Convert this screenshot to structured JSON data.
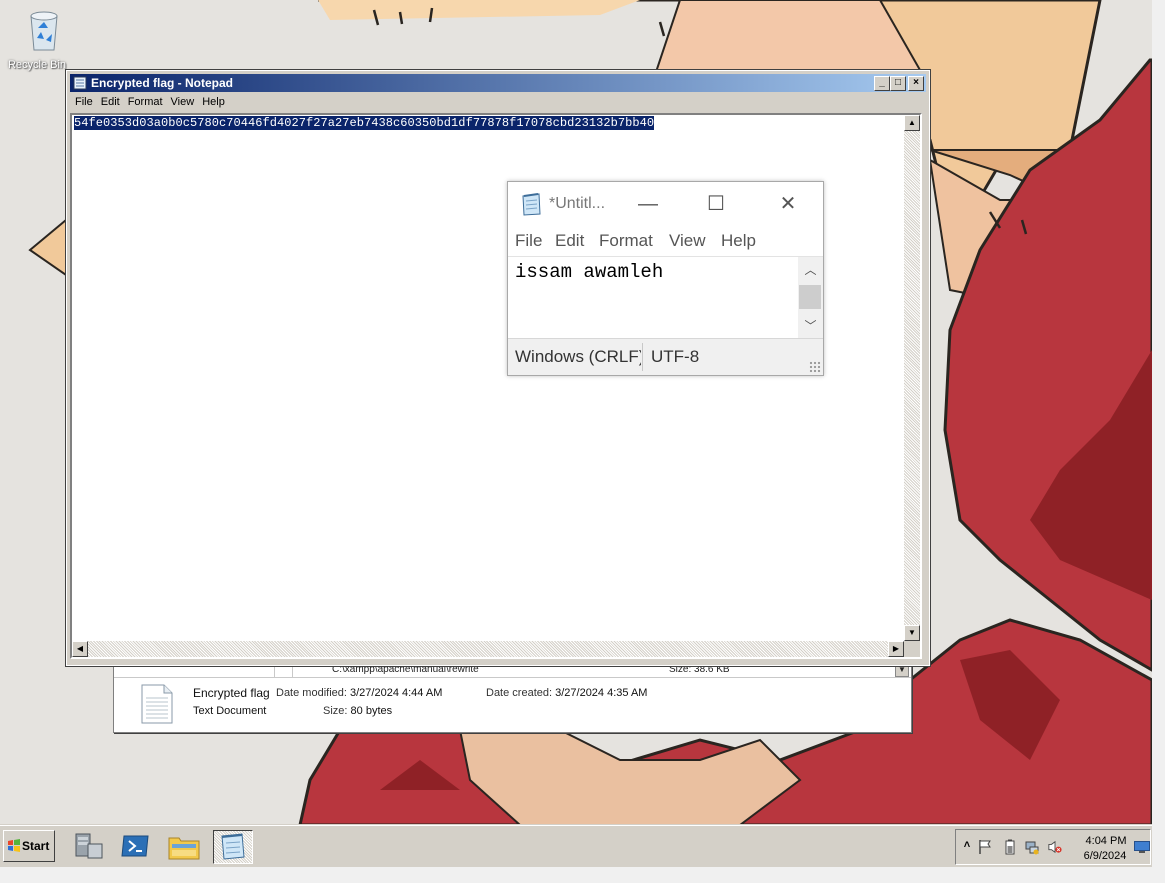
{
  "desktop": {
    "icons": [
      {
        "label": "Recycle Bin",
        "icon": "recycle-bin-icon"
      }
    ]
  },
  "explorer": {
    "path": "C:\\xampp\\apache\\manual\\rewrite",
    "path_size": "Size: 38.6 KB",
    "details": {
      "name": "Encrypted flag",
      "type": "Text Document",
      "modified_label": "Date modified:",
      "modified": "3/27/2024 4:44 AM",
      "created_label": "Date created:",
      "created": "3/27/2024 4:35 AM",
      "size_label": "Size:",
      "size": "80 bytes",
      "icon": "text-document-icon"
    }
  },
  "notepad_classic": {
    "title": "Encrypted flag - Notepad",
    "menu": [
      "File",
      "Edit",
      "Format",
      "View",
      "Help"
    ],
    "content": "54fe0353d03a0b0c5780c70446fd4027f27a27eb7438c60350bd1df77878f17078cbd23132b7bb40",
    "content_selected": true,
    "buttons": {
      "minimize": "_",
      "maximize": "□",
      "close": "×"
    }
  },
  "notepad_modern": {
    "title": "*Untitl...",
    "menu": [
      "File",
      "Edit",
      "Format",
      "View",
      "Help"
    ],
    "content": "issam awamleh",
    "status_line_ending": "Windows (CRLF)",
    "status_encoding": "UTF-8"
  },
  "taskbar": {
    "start_label": "Start",
    "apps": [
      "server-manager-icon",
      "powershell-icon",
      "file-explorer-icon",
      "notepad-icon"
    ],
    "active_app": "notepad-icon",
    "tray_icons": [
      "show-hidden-icons-chevron",
      "action-center-flag-icon",
      "battery-icon",
      "network-icon",
      "volume-muted-icon"
    ],
    "time": "4:04 PM",
    "date": "6/9/2024",
    "show_desktop_icon": "show-desktop-icon"
  },
  "colors": {
    "title_active_start": "#0a246a",
    "title_active_end": "#a6caf0",
    "selection": "#0a246a",
    "face": "#d4d0c8",
    "wallpaper_red": "#b8363e"
  }
}
